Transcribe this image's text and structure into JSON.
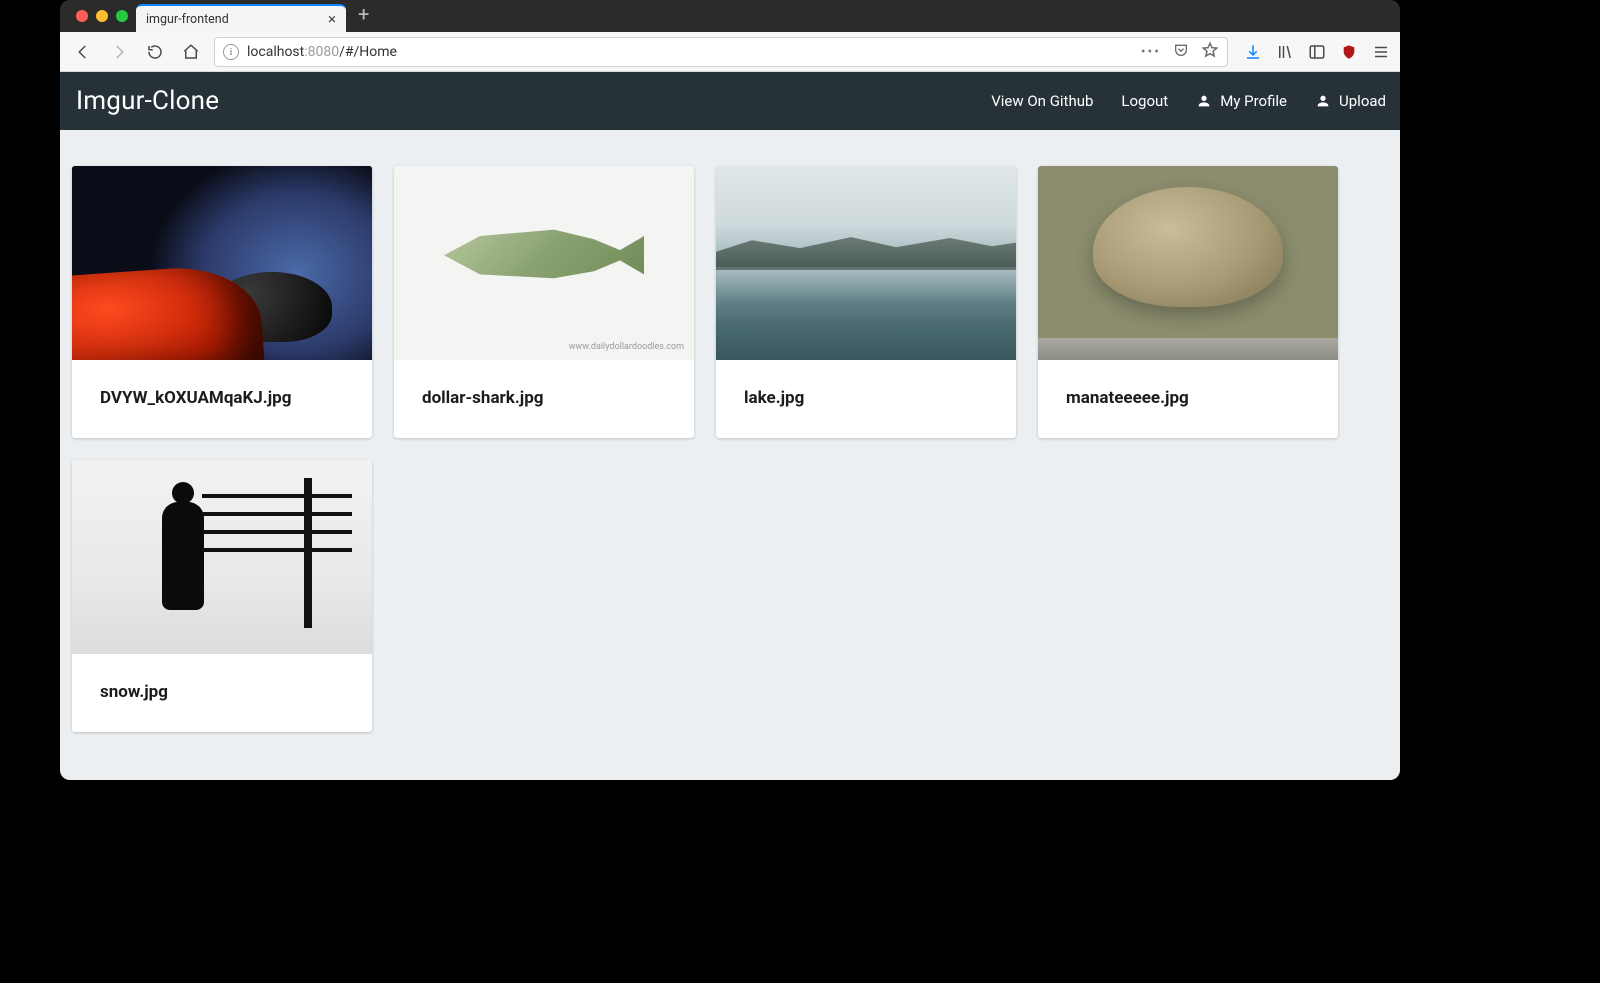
{
  "browser": {
    "tab_title": "imgur-frontend",
    "url_host": "localhost",
    "url_port": ":8080",
    "url_path": "/#/Home"
  },
  "app": {
    "brand": "Imgur-Clone",
    "nav": {
      "github": "View On Github",
      "logout": "Logout",
      "profile": "My Profile",
      "upload": "Upload"
    }
  },
  "cards": [
    {
      "title": "DVYW_kOXUAMqaKJ.jpg",
      "thumb": "spacecar"
    },
    {
      "title": "dollar-shark.jpg",
      "thumb": "shark",
      "watermark": "www.dailydollardoodles.com"
    },
    {
      "title": "lake.jpg",
      "thumb": "lake"
    },
    {
      "title": "manateeeee.jpg",
      "thumb": "manatee"
    },
    {
      "title": "snow.jpg",
      "thumb": "snow"
    }
  ]
}
